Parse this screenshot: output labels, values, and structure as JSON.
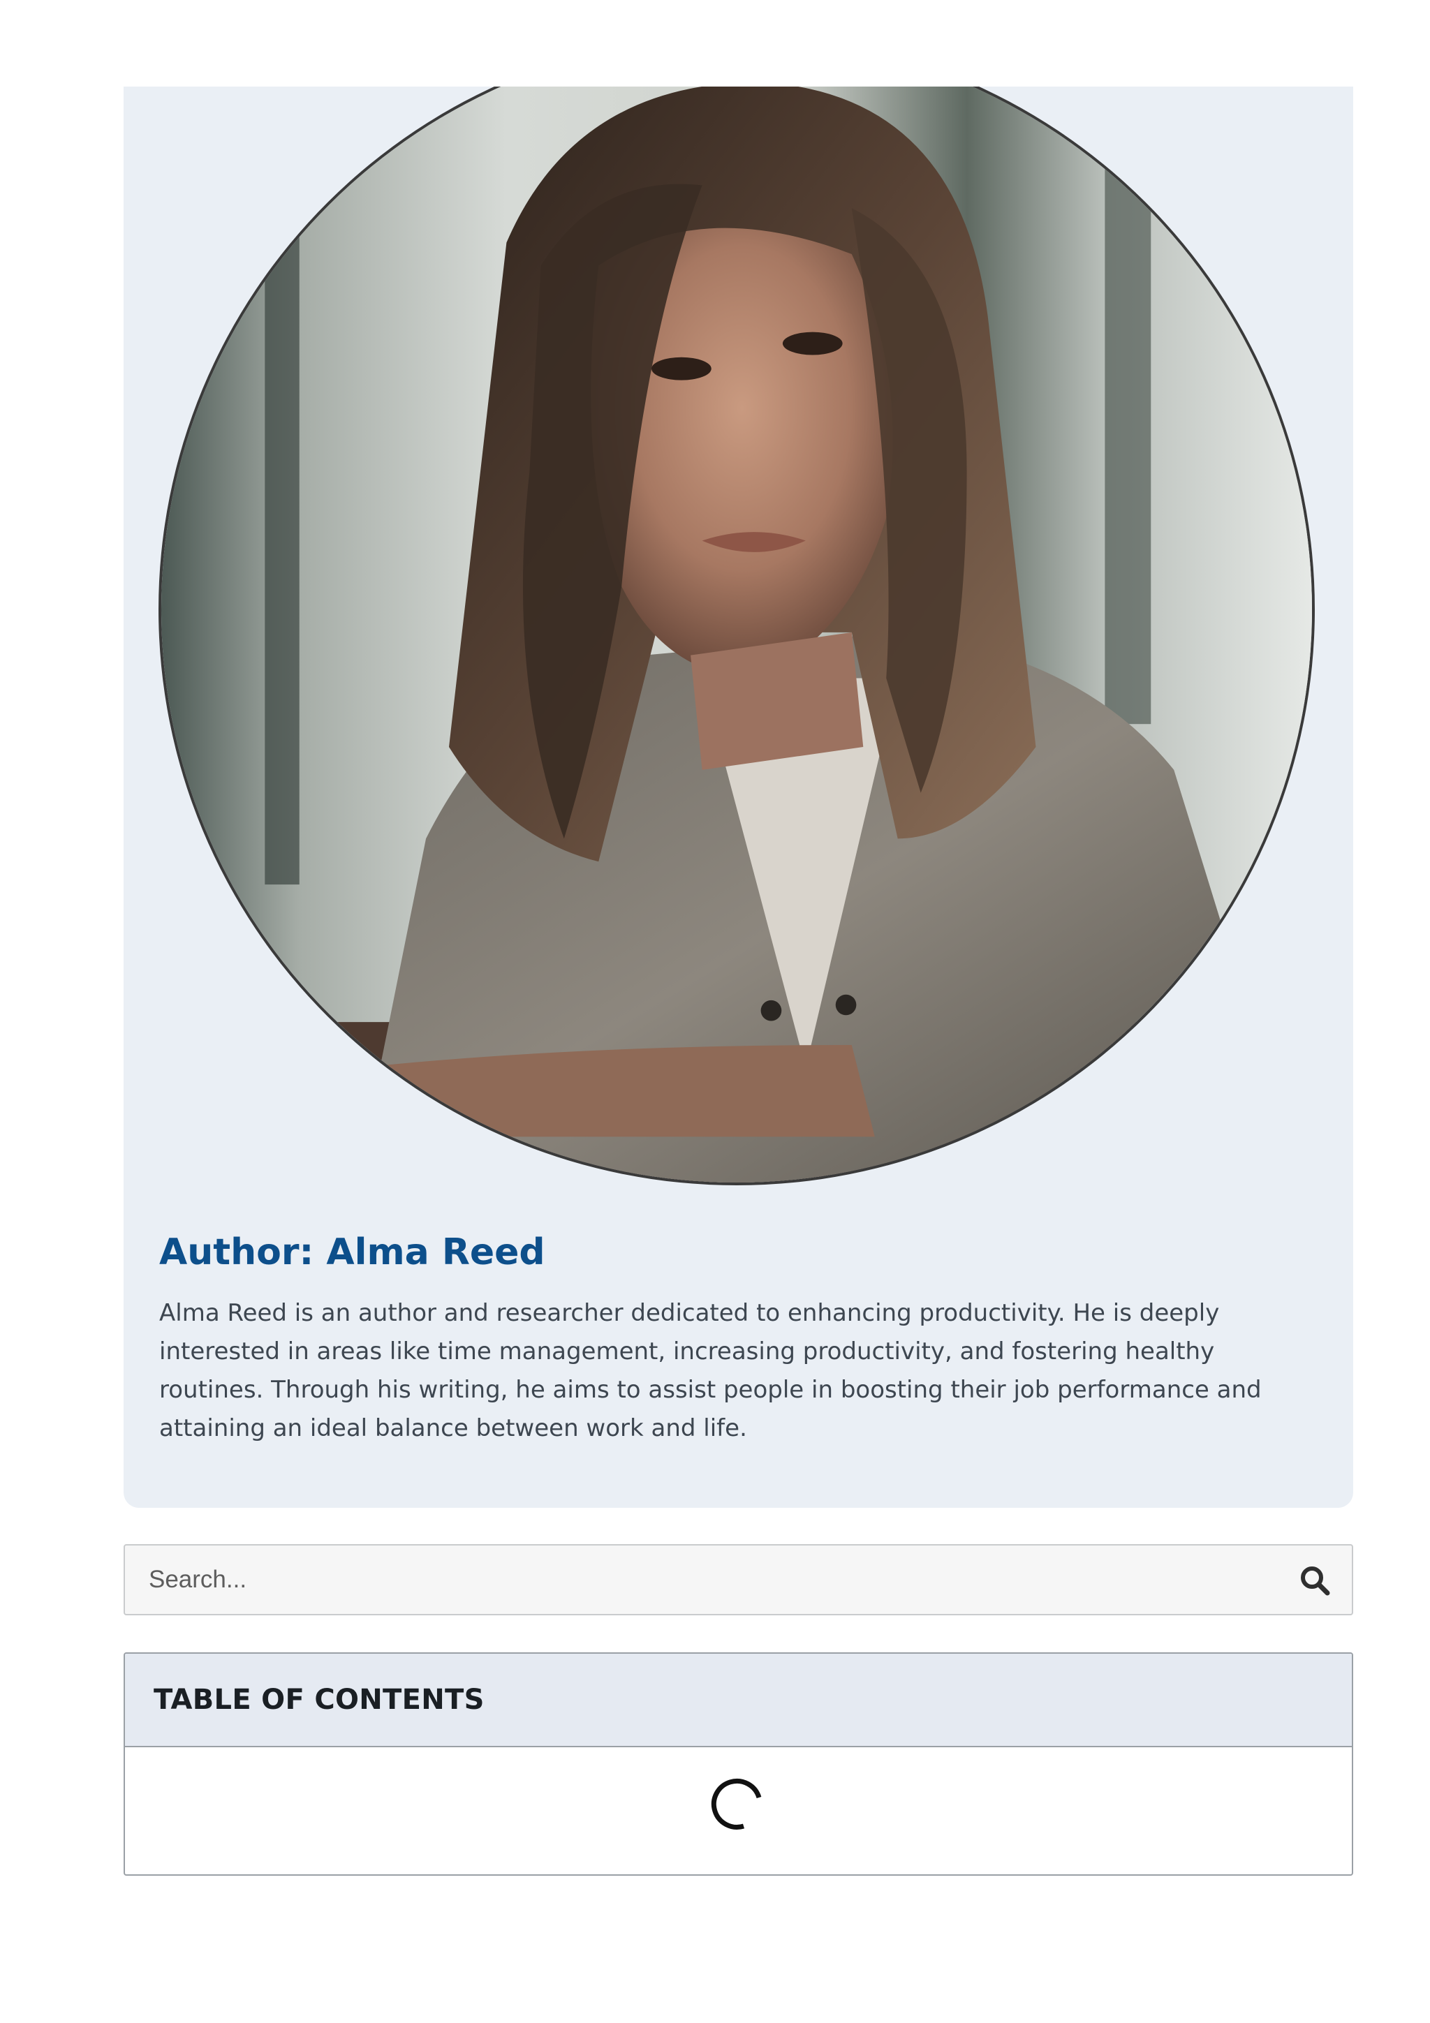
{
  "author": {
    "photo_alt": "Author photo",
    "title": "Author: Alma Reed",
    "bio": "Alma Reed is an author and researcher dedicated to enhancing productivity. He is deeply interested in areas like time management, increasing productivity, and fostering healthy routines. Through his writing, he aims to assist people in boosting their job performance and attaining an ideal balance between work and life."
  },
  "search": {
    "placeholder": "Search...",
    "value": "",
    "icon": "search-icon"
  },
  "toc": {
    "title": "TABLE OF CONTENTS",
    "state_icon": "loading-spinner-icon"
  },
  "colors": {
    "card_background": "#eaeff5",
    "title_blue": "#0d4f8b",
    "body_text": "#3d4650",
    "toc_header_background": "#e5eaf2"
  }
}
